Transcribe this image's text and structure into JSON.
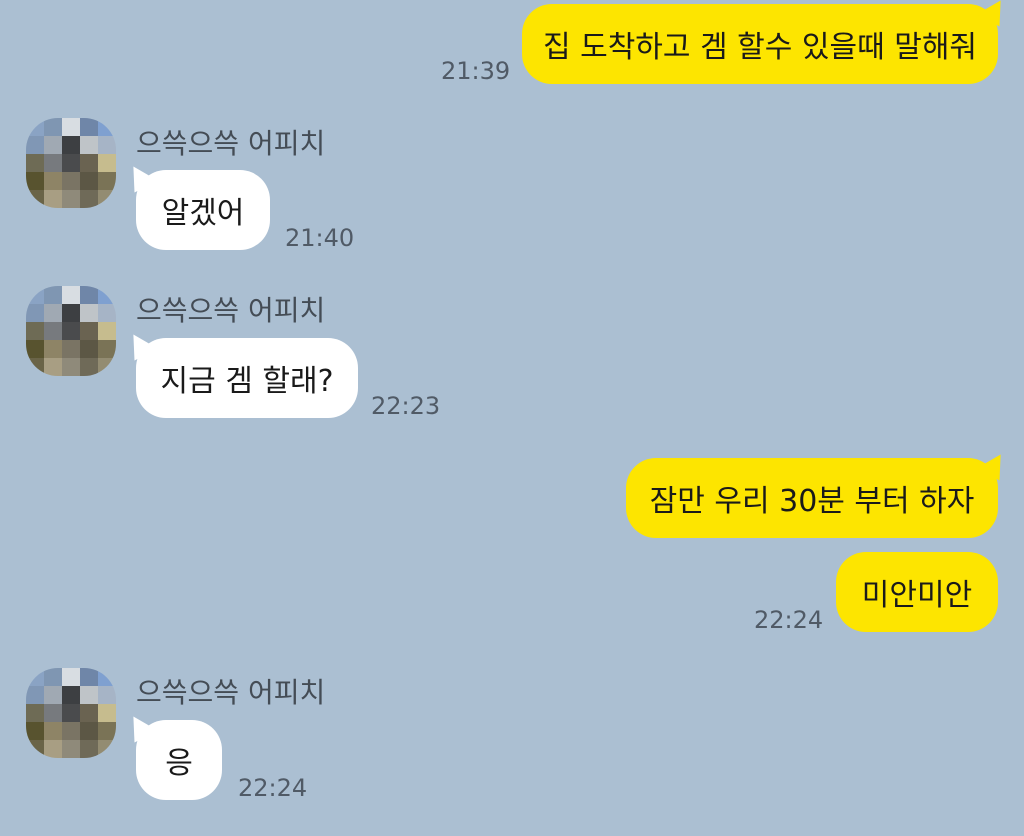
{
  "chat": {
    "contact_name": "으쓱으쓱 어피치",
    "messages": [
      {
        "from": "me",
        "text": "집 도착하고 겜 할수 있을때 말해줘",
        "time": "21:39"
      },
      {
        "from": "other",
        "text": "알겠어",
        "time": "21:40"
      },
      {
        "from": "other",
        "text": "지금 겜 할래?",
        "time": "22:23"
      },
      {
        "from": "me",
        "text": "잠만 우리 30분 부터 하자",
        "time": ""
      },
      {
        "from": "me",
        "text": "미안미안",
        "time": "22:24"
      },
      {
        "from": "other",
        "text": "응",
        "time": "22:24"
      }
    ]
  },
  "colors": {
    "background": "#abbfd2",
    "my_bubble": "#fde500",
    "other_bubble": "#ffffff"
  },
  "icons": {
    "avatar": "pixelated-profile-avatar"
  }
}
